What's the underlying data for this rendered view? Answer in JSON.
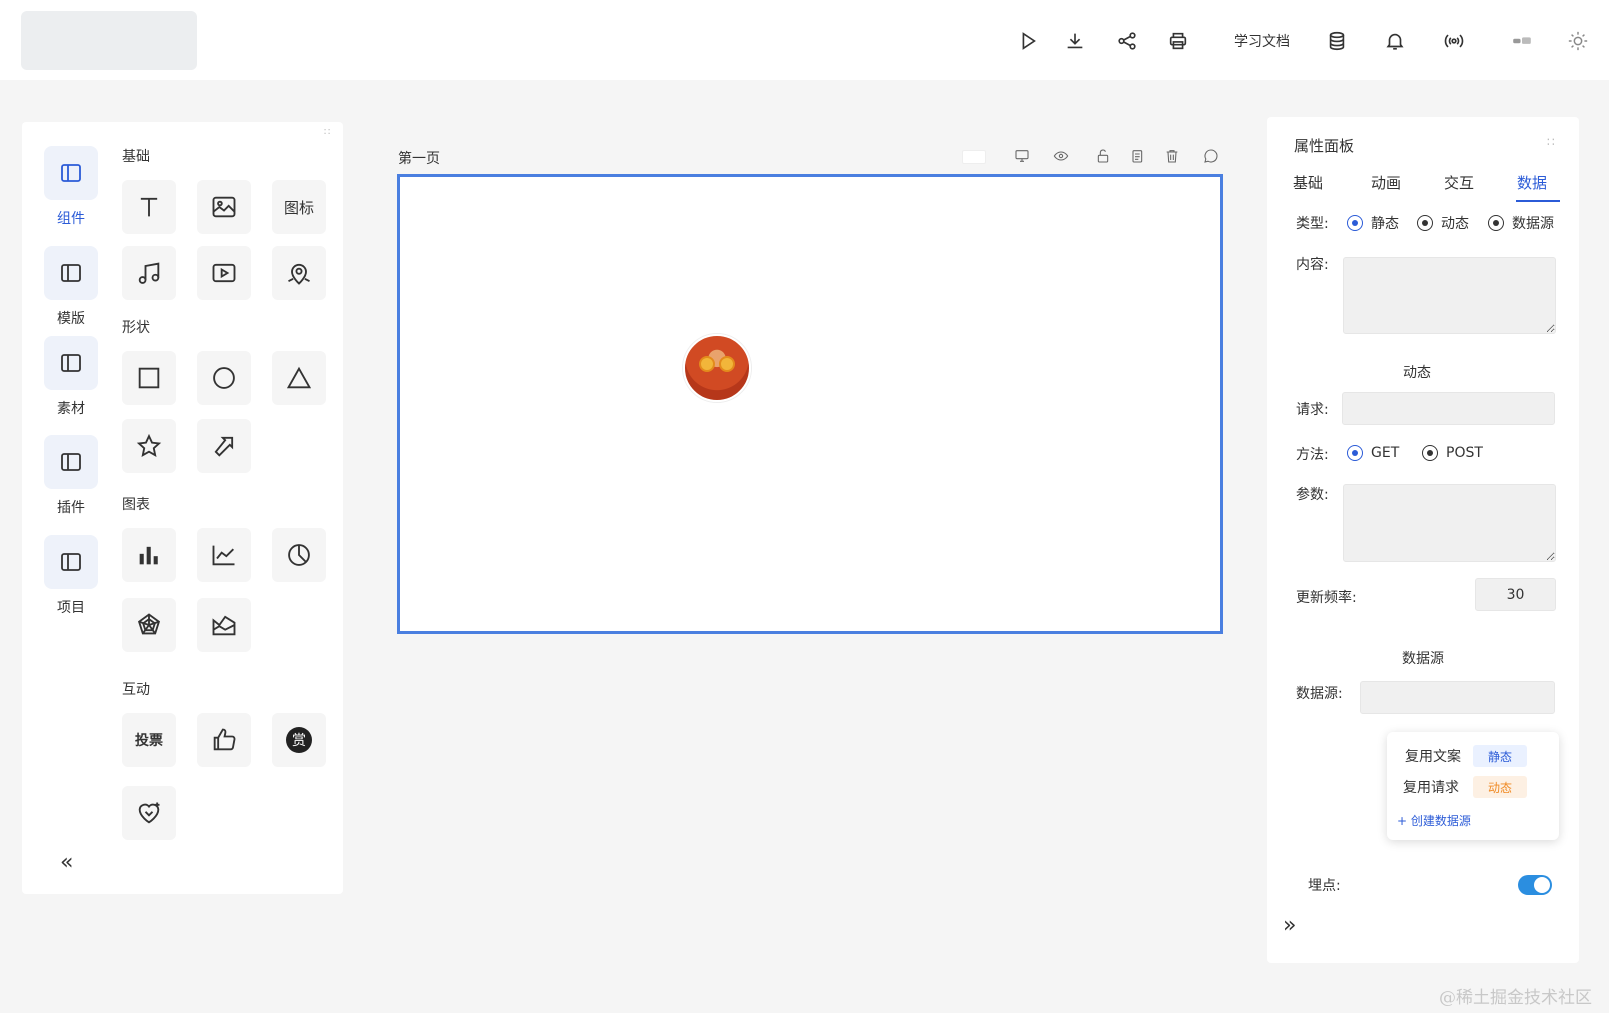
{
  "topbar": {
    "icons": [
      "play-icon",
      "download-icon",
      "share-icon",
      "print-icon",
      "database-icon",
      "bell-icon",
      "broadcast-icon",
      "language-icon",
      "theme-icon"
    ],
    "doc_link": "学习文档"
  },
  "left_nav": {
    "items": [
      {
        "label": "组件",
        "active": true
      },
      {
        "label": "模版",
        "active": false
      },
      {
        "label": "素材",
        "active": false
      },
      {
        "label": "插件",
        "active": false
      },
      {
        "label": "项目",
        "active": false
      }
    ],
    "collapse_glyph": "«"
  },
  "components": {
    "sections": [
      {
        "title": "基础",
        "items": [
          "text-icon",
          "image-icon",
          "图标",
          "audio-icon",
          "video-icon",
          "map-icon"
        ]
      },
      {
        "title": "形状",
        "items": [
          "square-icon",
          "circle-icon",
          "triangle-icon",
          "star-icon",
          "arrow-icon"
        ]
      },
      {
        "title": "图表",
        "items": [
          "bar-chart-icon",
          "line-chart-icon",
          "pie-chart-icon",
          "radar-chart-icon",
          "area-chart-icon"
        ]
      },
      {
        "title": "互动",
        "items": [
          "投票",
          "like-icon",
          "赏",
          "heart-icon"
        ]
      }
    ],
    "icon_text": "图标",
    "vote_text": "投票",
    "reward_text": "赏"
  },
  "canvas": {
    "page_title": "第一页",
    "border_color": "#4a7fe0"
  },
  "props_panel": {
    "title": "属性面板",
    "tabs": [
      "基础",
      "动画",
      "交互",
      "数据"
    ],
    "active_tab": "数据",
    "type_label": "类型:",
    "type_options": [
      "静态",
      "动态",
      "数据源"
    ],
    "content_label": "内容:",
    "dynamic_title": "动态",
    "request_label": "请求:",
    "method_label": "方法:",
    "method_options": [
      "GET",
      "POST"
    ],
    "params_label": "参数:",
    "freq_label": "更新频率:",
    "freq_value": "30",
    "datasource_title": "数据源",
    "datasource_label": "数据源:",
    "dropdown": {
      "items": [
        {
          "label": "复用文案",
          "tag": "静态",
          "tag_color": "#2b5bd7",
          "tag_bg": "#eaf1ff"
        },
        {
          "label": "复用请求",
          "tag": "动态",
          "tag_color": "#f08a24",
          "tag_bg": "#fdf0e3"
        }
      ],
      "create_label": "+  创建数据源"
    },
    "tracking_label": "埋点:",
    "tracking_on": true,
    "expand_glyph": "»"
  },
  "watermark": "@稀土掘金技术社区",
  "colors": {
    "accent": "#2b5bd7",
    "toggle": "#2b8ee0"
  }
}
